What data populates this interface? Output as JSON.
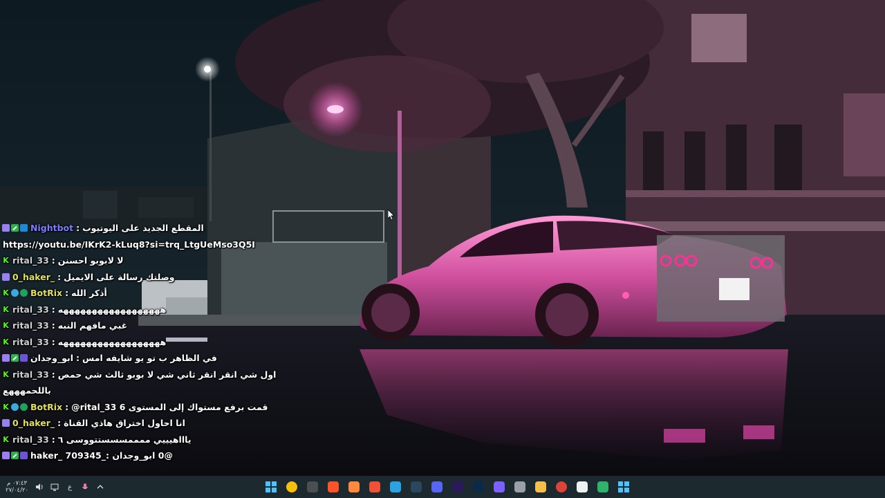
{
  "chat": {
    "messages": [
      {
        "user": "Nightbot",
        "user_color": "#7b7bff",
        "badges": [
          "sub-icon",
          "mod-icon",
          "bot-icon"
        ],
        "text": "المقطع الجديد على اليوتيوب"
      },
      {
        "user": "",
        "user_color": "#ffffff",
        "badges": [],
        "text": "https://youtu.be/IKrK2-kLuq8?si=trq_LtgUeMso3Q5I",
        "continuation": true
      },
      {
        "user": "rital_33",
        "user_color": "#d0d0d0",
        "badges": [
          "kick-icon"
        ],
        "text": "لا لابوبو احسنن"
      },
      {
        "user": "0_haker_",
        "user_color": "#e0e060",
        "badges": [
          "sub-icon"
        ],
        "text": "وصلتك رسالة على الايميل"
      },
      {
        "user": "BotRix",
        "user_color": "#e0e060",
        "badges": [
          "kick-icon",
          "vip-icon",
          "verified-icon"
        ],
        "text": "أذكر الله"
      },
      {
        "user": "rital_33",
        "user_color": "#d0d0d0",
        "badges": [
          "kick-icon"
        ],
        "text": "ههههههههههههههههههه"
      },
      {
        "user": "rital_33",
        "user_color": "#d0d0d0",
        "badges": [
          "kick-icon"
        ],
        "text": "غبي مافهم النبه"
      },
      {
        "user": "rital_33",
        "user_color": "#d0d0d0",
        "badges": [
          "kick-icon"
        ],
        "text": "ههههههههههههههههههه"
      },
      {
        "user": "ابو_وجدان",
        "user_color": "#ffffff",
        "badges": [
          "sub-icon",
          "mod-icon",
          "sticker-icon"
        ],
        "text": "في الظاهر ب تو يو شايفه امس"
      },
      {
        "user": "rital_33",
        "user_color": "#d0d0d0",
        "badges": [
          "kick-icon"
        ],
        "text": "اول شي انقر انقر ثاني شي لا بوبو ثالث شي حمص"
      },
      {
        "user": "",
        "user_color": "#ffffff",
        "badges": [],
        "text": "باللحمهههع",
        "continuation": true
      },
      {
        "user": "BotRix",
        "user_color": "#e0e060",
        "badges": [
          "kick-icon",
          "vip-icon",
          "verified-icon"
        ],
        "text": "@rital_33 قمت برفع مستواك إلى المستوى 6"
      },
      {
        "user": "0_haker_",
        "user_color": "#e0e060",
        "badges": [
          "sub-icon"
        ],
        "text": "انا احاول اختراق هاذي القناة"
      },
      {
        "user": "rital_33",
        "user_color": "#d0d0d0",
        "badges": [
          "kick-icon"
        ],
        "text": "ياااهيييي ممممسسستتووسى ٦"
      },
      {
        "user": "",
        "user_color": "#ffffff",
        "badges": [
          "sub-icon",
          "mod-icon",
          "sticker-icon"
        ],
        "text": "@0 ابو_وجدان :_haker_ 709345"
      }
    ]
  },
  "taskbar": {
    "clock_time": "٠٧:٤٣ م",
    "clock_date": "٢٧/٠٤/٢٠",
    "keyboard_lang": "ع",
    "apps": [
      "start-icon",
      "chrome-icon",
      "xbox-icon",
      "brave-icon",
      "aseprite-icon",
      "git-icon",
      "telegram-icon",
      "steam-icon",
      "discord-icon",
      "premiere-icon",
      "photoshop-icon",
      "dev-icon",
      "github-icon",
      "files-icon",
      "chrome-profile-icon",
      "store-icon",
      "edge-icon",
      "windows-apps-icon"
    ]
  },
  "colors": {
    "accent_pink": "#ff4fbf",
    "night_sky": "#0d1620",
    "kick_green": "#53fc18"
  }
}
